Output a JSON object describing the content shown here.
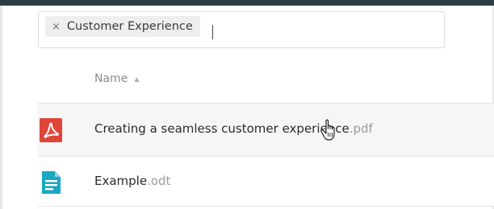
{
  "filter": {
    "tags": [
      {
        "label": "Customer Experience",
        "remove_symbol": "×"
      }
    ]
  },
  "list": {
    "columns": [
      {
        "label": "Name",
        "sort": "ascending"
      }
    ],
    "sort_symbol": "▲",
    "files": [
      {
        "base": "Creating a seamless customer experience",
        "ext": ".pdf",
        "icon": "pdf-icon",
        "color": "#e0453a",
        "selected": true
      },
      {
        "base": "Example",
        "ext": ".odt",
        "icon": "document-icon",
        "color": "#1aa7c4",
        "selected": false
      }
    ]
  }
}
